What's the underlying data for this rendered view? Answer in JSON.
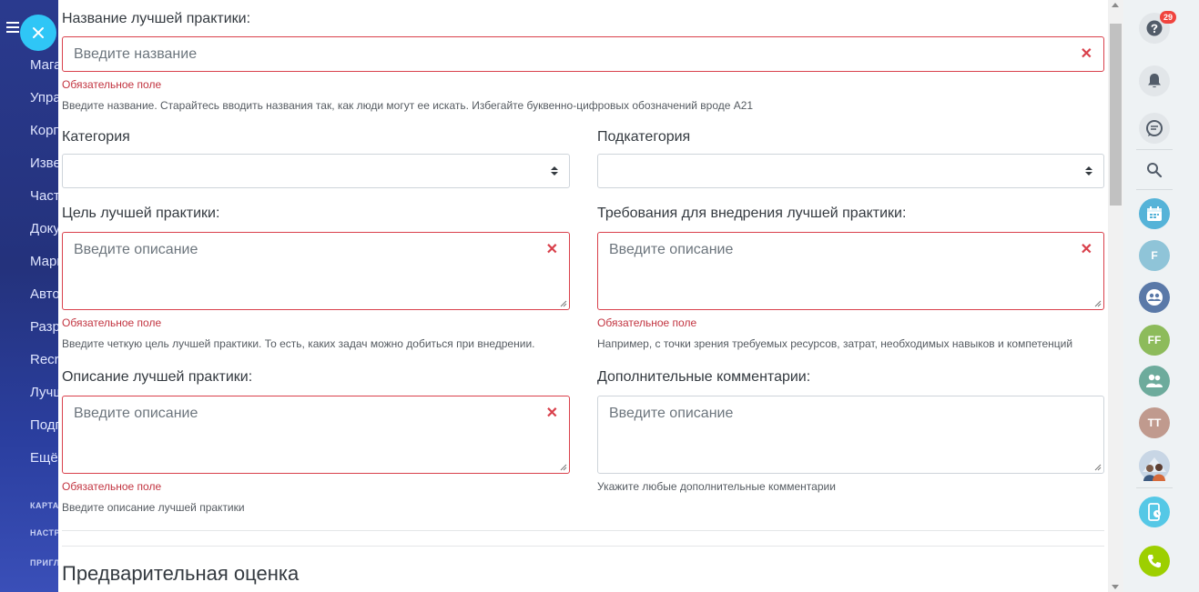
{
  "left_sidebar": {
    "items": [
      "Мага",
      "Упра",
      "Корп",
      "Изве",
      "Част",
      "Доку",
      "Марк",
      "Авто",
      "Разр",
      "Recru",
      "Лучш",
      "Подп",
      "Ещё"
    ],
    "sections": [
      "КАРТА",
      "НАСТР",
      "ПРИГЛ"
    ]
  },
  "form": {
    "name": {
      "label": "Название лучшей практики:",
      "placeholder": "Введите название",
      "error": "Обязательное поле",
      "hint": "Введите название. Старайтесь вводить названия так, как люди могут ее искать. Избегайте буквенно-цифровых обозначений вроде А21"
    },
    "category": {
      "label": "Категория",
      "value": ""
    },
    "subcategory": {
      "label": "Подкатегория",
      "value": ""
    },
    "goal": {
      "label": "Цель лучшей практики:",
      "placeholder": "Введите описание",
      "error": "Обязательное поле",
      "hint": "Введите четкую цель лучшей практики. То есть, каких задач можно добиться при внедрении."
    },
    "requirements": {
      "label": "Требования для внедрения лучшей практики:",
      "placeholder": "Введите описание",
      "error": "Обязательное поле",
      "hint": "Например, с точки зрения требуемых ресурсов, затрат, необходимых навыков и компетенций"
    },
    "description": {
      "label": "Описание лучшей практики:",
      "placeholder": "Введите описание",
      "error": "Обязательное поле",
      "hint": "Введите описание лучшей практики"
    },
    "comments": {
      "label": "Дополнительные комментарии:",
      "placeholder": "Введите описание",
      "hint": "Укажите любые дополнительные комментарии"
    },
    "section_title": "Предварительная оценка"
  },
  "right_sidebar": {
    "help_badge": "29",
    "avatars": [
      "F",
      "FF",
      "TT"
    ]
  },
  "colors": {
    "error": "#d9404b",
    "sidebar_blue": "#2a3a8e",
    "close_button": "#2fc6f6",
    "call_button": "#9dcf00"
  }
}
